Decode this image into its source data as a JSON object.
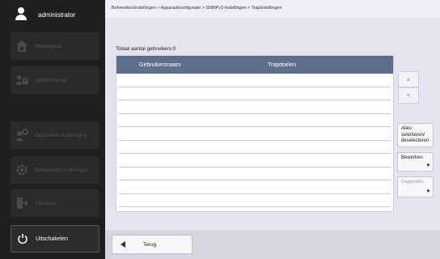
{
  "user": {
    "name": "administrator"
  },
  "sidebar": {
    "items": [
      {
        "label": "Startpagina",
        "icon": "home-icon"
      },
      {
        "label": "Opdrachtknop",
        "icon": "person-copier-icon"
      },
      {
        "label": "Gebruikers instellingen",
        "icon": "user-gear-icon"
      },
      {
        "label": "Beheerders instellingen",
        "icon": "gear-icon"
      },
      {
        "label": "Afmelden",
        "icon": "logout-icon"
      },
      {
        "label": "Uitschakelen",
        "icon": "power-icon"
      }
    ]
  },
  "breadcrumb": "Beheerdersinstellingen > Apparaatconfiguratie > SNMPv3-instellingen > Trapinstellingen",
  "total_label": "Totaal aantal gebruikers:0",
  "table": {
    "columns": [
      "Gebruikersnaam",
      "Trapdoelen"
    ],
    "rows": []
  },
  "scroll": {
    "up": "▲",
    "down": "▼"
  },
  "actions": {
    "select_all": "Alles selecteren/ deselecteren",
    "edit": "Bewerken",
    "details": "Gegevens."
  },
  "back_label": "Terug"
}
